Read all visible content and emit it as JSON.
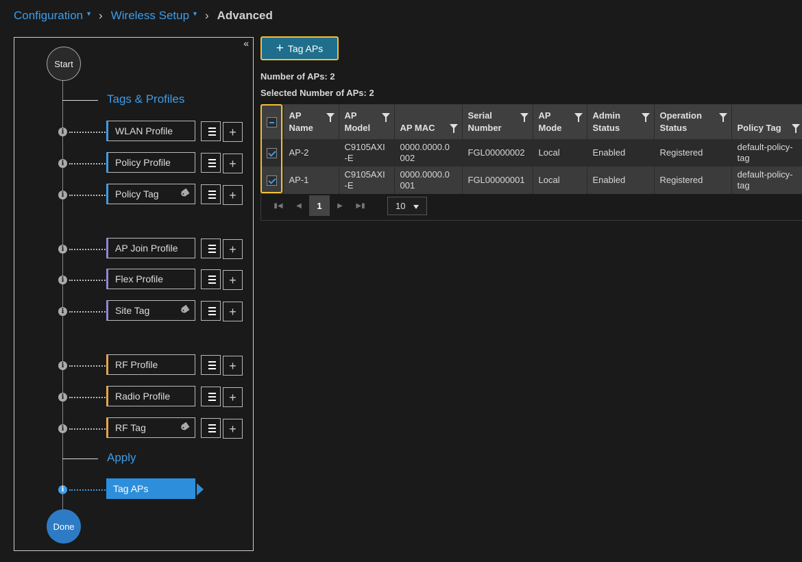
{
  "breadcrumb": {
    "items": [
      "Configuration",
      "Wireless Setup"
    ],
    "current": "Advanced"
  },
  "wizard": {
    "start_label": "Start",
    "done_label": "Done",
    "section_tags_profiles": "Tags & Profiles",
    "section_apply": "Apply",
    "steps": [
      {
        "label": "WLAN Profile",
        "accent": "#3d9ce8"
      },
      {
        "label": "Policy Profile",
        "accent": "#3d9ce8"
      },
      {
        "label": "Policy Tag",
        "accent": "#3d9ce8",
        "icon": "tag-icon"
      },
      {
        "label": "AP Join Profile",
        "accent": "#8e86d6"
      },
      {
        "label": "Flex Profile",
        "accent": "#8e86d6"
      },
      {
        "label": "Site Tag",
        "accent": "#8e86d6",
        "icon": "tag-icon"
      },
      {
        "label": "RF Profile",
        "accent": "#e6a64a"
      },
      {
        "label": "Radio Profile",
        "accent": "#e6a64a"
      },
      {
        "label": "RF Tag",
        "accent": "#e6a64a",
        "icon": "tag-icon"
      }
    ],
    "apply_step": "Tag APs"
  },
  "toolbar": {
    "tag_aps_label": "Tag APs"
  },
  "counts": {
    "number_of_aps": "Number of APs: 2",
    "selected_number_of_aps": "Selected Number of APs: 2"
  },
  "table": {
    "columns": [
      {
        "line1": "AP",
        "line2": "Name"
      },
      {
        "line1": "AP",
        "line2": "Model"
      },
      {
        "line1": "AP MAC",
        "line2": ""
      },
      {
        "line1": "Serial",
        "line2": "Number"
      },
      {
        "line1": "AP",
        "line2": "Mode"
      },
      {
        "line1": "Admin",
        "line2": "Status"
      },
      {
        "line1": "Operation",
        "line2": "Status"
      },
      {
        "line1": "Policy Tag",
        "line2": ""
      }
    ],
    "rows": [
      {
        "ap_name": "AP-2",
        "model_1": "C9105AXI",
        "model_2": "-E",
        "mac_1": "0000.0000.0",
        "mac_2": "002",
        "serial": "FGL00000002",
        "mode": "Local",
        "admin": "Enabled",
        "oper": "Registered",
        "tag_1": "default-policy-",
        "tag_2": "tag"
      },
      {
        "ap_name": "AP-1",
        "model_1": "C9105AXI",
        "model_2": "-E",
        "mac_1": "0000.0000.0",
        "mac_2": "001",
        "serial": "FGL00000001",
        "mode": "Local",
        "admin": "Enabled",
        "oper": "Registered",
        "tag_1": "default-policy-",
        "tag_2": "tag"
      }
    ]
  },
  "pager": {
    "current_page": "1",
    "page_size": "10"
  },
  "colors": {
    "accent_blue": "#3d9ce8",
    "highlight_yellow": "#f2c033",
    "button_teal": "#1f6e8c"
  }
}
